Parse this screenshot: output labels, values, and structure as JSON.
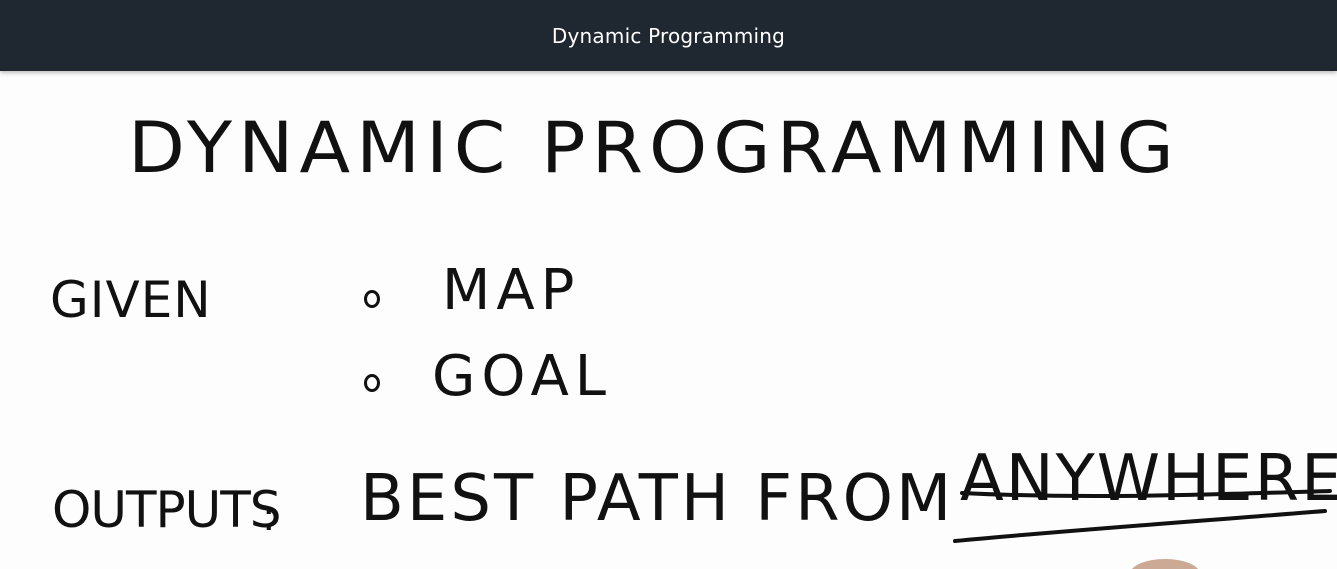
{
  "header": {
    "title": "Dynamic Programming"
  },
  "whiteboard": {
    "heading": "DYNAMIC PROGRAMMING",
    "given_label": "GIVEN",
    "given_items": [
      "MAP",
      "GOAL"
    ],
    "outputs_label": "OUTPUTS",
    "outputs_colon": ":",
    "outputs_text": "BEST PATH FROM",
    "outputs_emphasis": "ANYWHERE"
  },
  "colors": {
    "header_bg": "#1f2731",
    "header_text": "#ffffff",
    "ink": "#111111",
    "board_bg": "#fdfdfd"
  }
}
